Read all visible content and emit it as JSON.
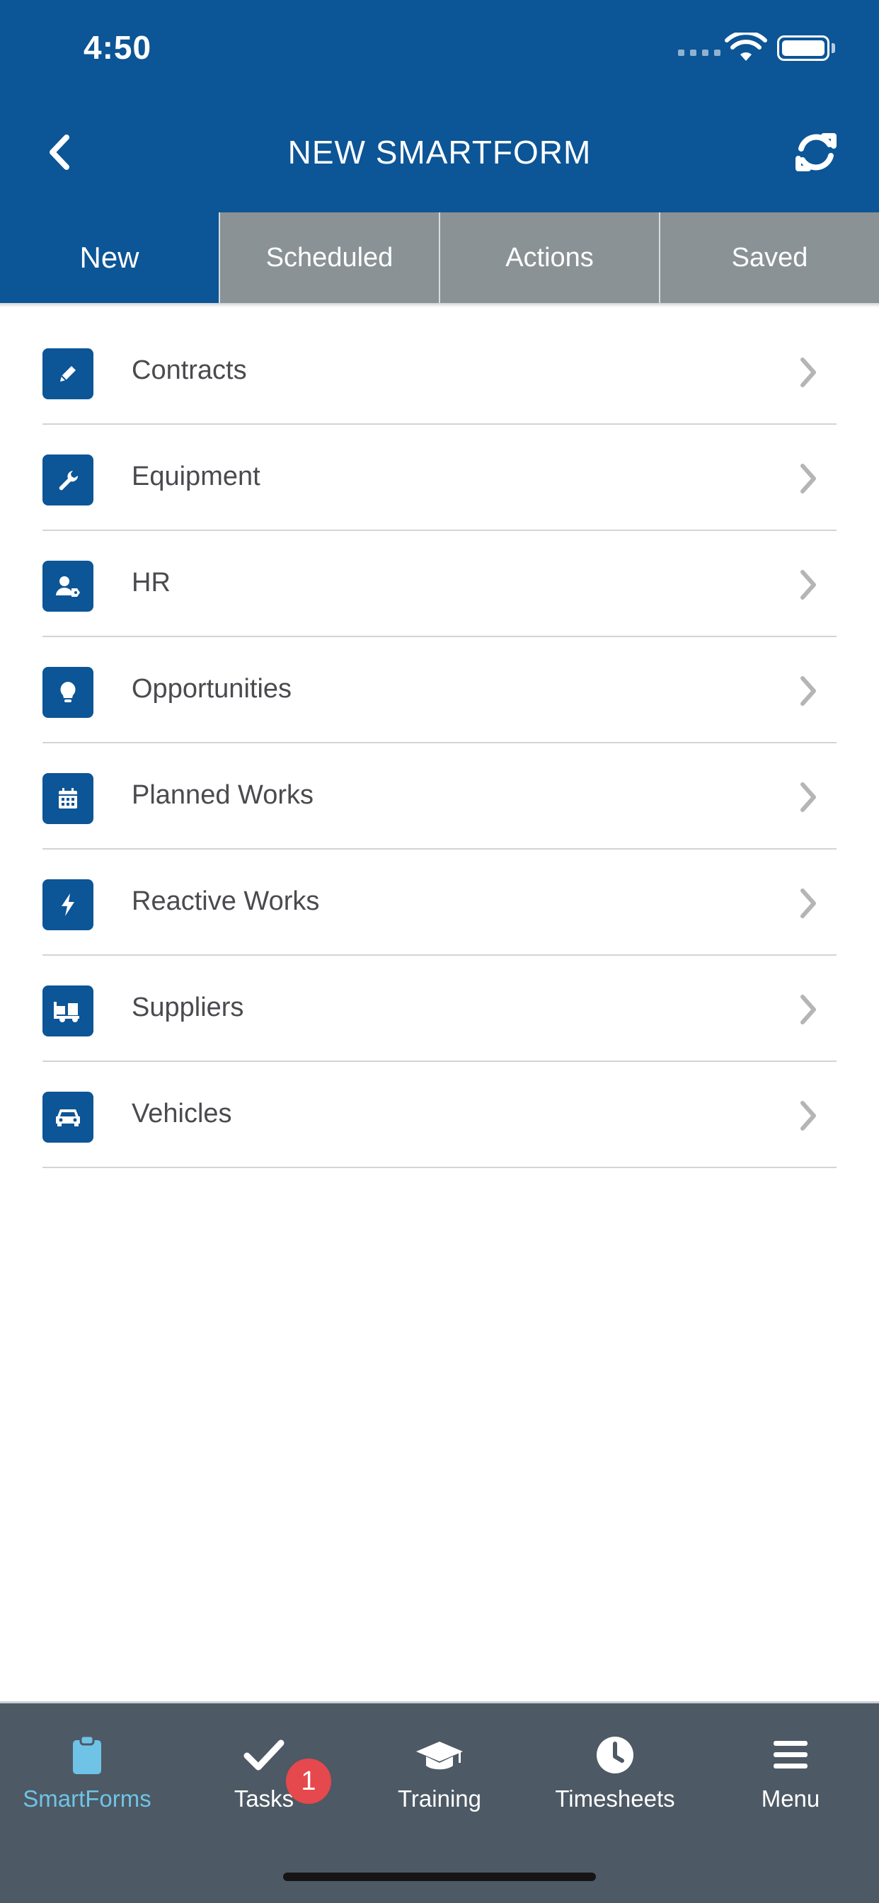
{
  "status_bar": {
    "time": "4:50"
  },
  "header": {
    "title": "NEW SMARTFORM",
    "back_icon": "chevron-left-icon",
    "refresh_icon": "refresh-icon"
  },
  "tabs": [
    {
      "label": "New",
      "active": true
    },
    {
      "label": "Scheduled",
      "active": false
    },
    {
      "label": "Actions",
      "active": false
    },
    {
      "label": "Saved",
      "active": false
    }
  ],
  "categories": [
    {
      "label": "Contracts",
      "icon": "pencil-icon"
    },
    {
      "label": "Equipment",
      "icon": "wrench-icon"
    },
    {
      "label": "HR",
      "icon": "user-tag-icon"
    },
    {
      "label": "Opportunities",
      "icon": "lightbulb-icon"
    },
    {
      "label": "Planned Works",
      "icon": "calendar-icon"
    },
    {
      "label": "Reactive Works",
      "icon": "bolt-icon"
    },
    {
      "label": "Suppliers",
      "icon": "truck-loading-icon"
    },
    {
      "label": "Vehicles",
      "icon": "car-icon"
    }
  ],
  "tab_bar": {
    "items": [
      {
        "label": "SmartForms",
        "icon": "clipboard-icon",
        "active": true
      },
      {
        "label": "Tasks",
        "icon": "checkmark-icon",
        "badge": "1"
      },
      {
        "label": "Training",
        "icon": "graduation-cap-icon"
      },
      {
        "label": "Timesheets",
        "icon": "clock-icon"
      },
      {
        "label": "Menu",
        "icon": "hamburger-menu-icon"
      }
    ]
  },
  "colors": {
    "brand": "#0c5596",
    "tab_inactive": "#8a9296",
    "tab_bar": "#4d5964",
    "active_tab_label": "#6fc3e6",
    "badge": "#e5484d"
  }
}
